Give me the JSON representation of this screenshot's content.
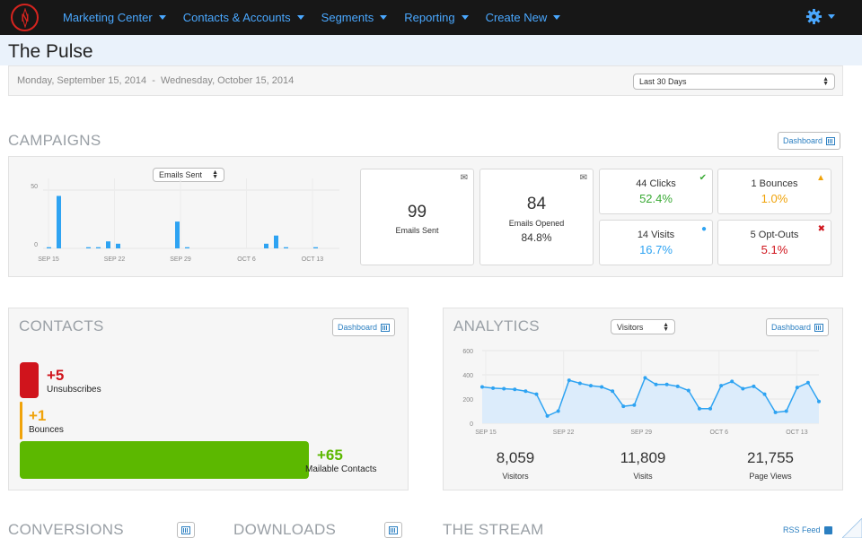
{
  "nav": {
    "logo_icon": "compass-n-logo",
    "items": [
      {
        "label": "Marketing Center"
      },
      {
        "label": "Contacts & Accounts"
      },
      {
        "label": "Segments"
      },
      {
        "label": "Reporting"
      },
      {
        "label": "Create New"
      }
    ],
    "settings_icon": "gear-icon"
  },
  "page": {
    "title": "The Pulse",
    "date_range": "Monday, September 15, 2014  -  Wednesday, October 15, 2014",
    "range_select": "Last 30 Days"
  },
  "campaigns": {
    "title": "CAMPAIGNS",
    "dashboard_label": "Dashboard",
    "chart_select": "Emails Sent",
    "chart_data": {
      "type": "bar",
      "y_ticks": [
        "50",
        "0"
      ],
      "ylim": [
        0,
        60
      ],
      "x_tick_labels": [
        "SEP 15",
        "SEP 22",
        "SEP 29",
        "OCT 6",
        "OCT 13"
      ],
      "values": [
        1,
        45,
        0,
        0,
        1,
        1,
        6,
        4,
        0,
        0,
        0,
        0,
        0,
        23,
        1,
        0,
        0,
        0,
        0,
        0,
        0,
        0,
        4,
        11,
        1,
        0,
        0,
        1,
        0,
        0
      ],
      "color": "#2ea3f2"
    },
    "emails_sent": {
      "value": "99",
      "label": "Emails Sent",
      "icon": "envelope-closed-icon"
    },
    "emails_opened": {
      "value": "84",
      "label": "Emails Opened",
      "pct": "84.8%",
      "icon": "envelope-open-icon"
    },
    "clicks": {
      "label": "44 Clicks",
      "pct": "52.4%",
      "color": "#3aaa35",
      "icon": "checkmark-icon"
    },
    "bounces": {
      "label": "1 Bounces",
      "pct": "1.0%",
      "color": "#f0a30a",
      "icon": "warning-icon"
    },
    "visits": {
      "label": "14 Visits",
      "pct": "16.7%",
      "color": "#2ea3f2",
      "icon": "globe-icon"
    },
    "optouts": {
      "label": "5 Opt-Outs",
      "pct": "5.1%",
      "color": "#d0141c",
      "icon": "x-icon"
    }
  },
  "contacts": {
    "title": "CONTACTS",
    "dashboard_label": "Dashboard",
    "unsubscribes": {
      "value": "+5",
      "label": "Unsubscribes",
      "color": "#d0141c"
    },
    "bounces": {
      "value": "+1",
      "label": "Bounces",
      "color": "#f0a30a"
    },
    "mailable": {
      "value": "+65",
      "label": "Mailable Contacts",
      "color": "#5cb800"
    }
  },
  "analytics": {
    "title": "ANALYTICS",
    "select": "Visitors",
    "dashboard_label": "Dashboard",
    "chart_data": {
      "type": "area",
      "y_ticks": [
        "600",
        "400",
        "200",
        "0"
      ],
      "ylim": [
        0,
        600
      ],
      "x_tick_labels": [
        "SEP 15",
        "SEP 22",
        "SEP 29",
        "OCT 6",
        "OCT 13"
      ],
      "values": [
        300,
        290,
        285,
        280,
        265,
        240,
        60,
        100,
        355,
        330,
        310,
        300,
        265,
        140,
        150,
        375,
        320,
        320,
        305,
        270,
        120,
        120,
        310,
        345,
        285,
        305,
        240,
        90,
        100,
        295,
        335,
        180
      ],
      "color": "#2ea3f2"
    },
    "stats": [
      {
        "value": "8,059",
        "label": "Visitors"
      },
      {
        "value": "11,809",
        "label": "Visits"
      },
      {
        "value": "21,755",
        "label": "Page Views"
      }
    ]
  },
  "bottom": {
    "conversions": "CONVERSIONS",
    "downloads": "DOWNLOADS",
    "stream": "THE STREAM",
    "rss_label": "RSS Feed"
  }
}
